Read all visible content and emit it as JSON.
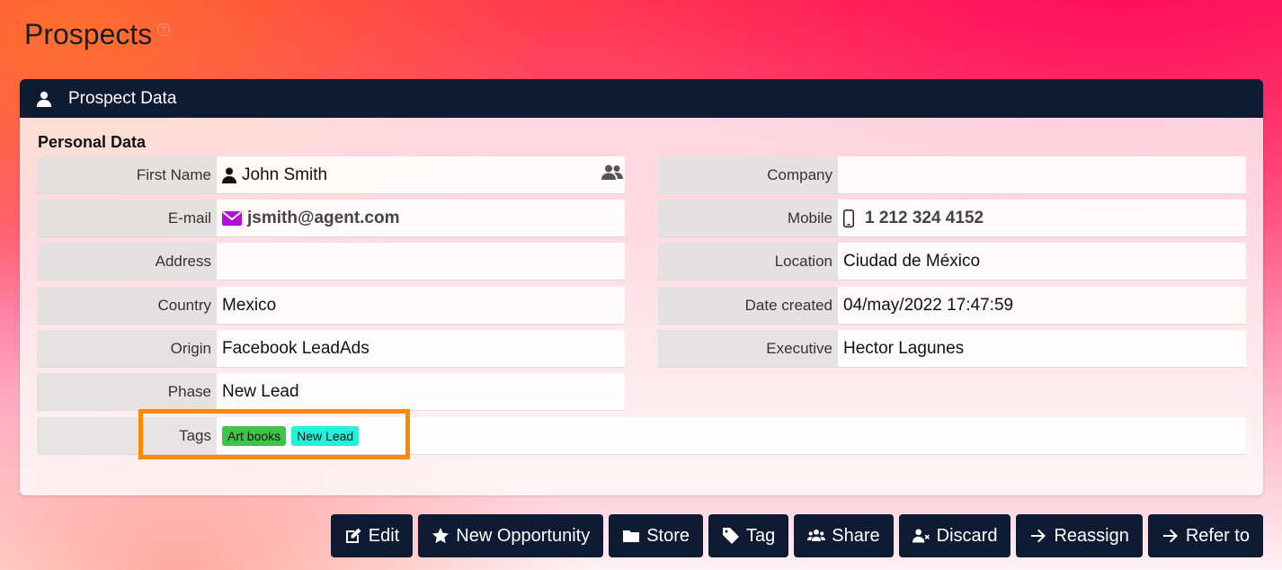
{
  "page": {
    "title": "Prospects",
    "help": "?"
  },
  "panel": {
    "header_title": "Prospect Data",
    "section_title": "Personal Data"
  },
  "left_fields": [
    {
      "label": "First Name",
      "value": "John Smith"
    },
    {
      "label": "E-mail",
      "value": "jsmith@agent.com"
    },
    {
      "label": "Address",
      "value": ""
    },
    {
      "label": "Country",
      "value": "Mexico"
    },
    {
      "label": "Origin",
      "value": "Facebook LeadAds"
    },
    {
      "label": "Phase",
      "value": "New Lead"
    }
  ],
  "right_fields": [
    {
      "label": "Company",
      "value": ""
    },
    {
      "label": "Mobile",
      "value": "1 212 324 4152"
    },
    {
      "label": "Location",
      "value": "Ciudad de México"
    },
    {
      "label": "Date created",
      "value": "04/may/2022 17:47:59"
    },
    {
      "label": "Executive",
      "value": "Hector Lagunes"
    }
  ],
  "tags": {
    "label": "Tags",
    "items": [
      {
        "label": "Art books",
        "color": "#3cc546"
      },
      {
        "label": "New Lead",
        "color": "#25f0dc"
      }
    ]
  },
  "actions": {
    "edit": "Edit",
    "new_opportunity": "New Opportunity",
    "store": "Store",
    "tag": "Tag",
    "share": "Share",
    "discard": "Discard",
    "reassign": "Reassign",
    "refer_to": "Refer to"
  },
  "colors": {
    "header_bg": "#0f1a33",
    "highlight": "#ff8a00",
    "email_icon": "#b10fd6"
  },
  "icons": {
    "header": "user-icon",
    "first_name": "user-icon",
    "contacts": "users-icon",
    "email": "envelope-icon",
    "mobile": "mobile-phone-icon"
  }
}
